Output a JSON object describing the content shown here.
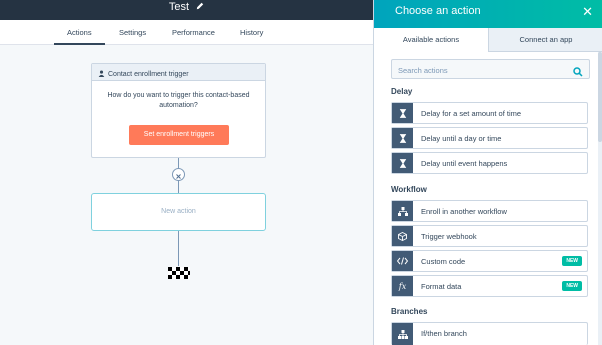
{
  "header": {
    "title": "Test"
  },
  "tabs": [
    {
      "label": "Actions",
      "active": true
    },
    {
      "label": "Settings",
      "active": false
    },
    {
      "label": "Performance",
      "active": false
    },
    {
      "label": "History",
      "active": false
    }
  ],
  "canvas": {
    "trigger_card": {
      "title": "Contact enrollment trigger",
      "question": "How do you want to trigger this contact-based automation?",
      "button": "Set enrollment triggers"
    },
    "new_action": "New action"
  },
  "panel": {
    "title": "Choose an action",
    "tabs": [
      "Available actions",
      "Connect an app"
    ],
    "search_placeholder": "Search actions",
    "sections": [
      {
        "title": "Delay",
        "items": [
          {
            "label": "Delay for a set amount of time",
            "icon": "hourglass-icon"
          },
          {
            "label": "Delay until a day or time",
            "icon": "hourglass-icon"
          },
          {
            "label": "Delay until event happens",
            "icon": "hourglass-icon"
          }
        ]
      },
      {
        "title": "Workflow",
        "items": [
          {
            "label": "Enroll in another workflow",
            "icon": "workflow-icon"
          },
          {
            "label": "Trigger webhook",
            "icon": "webhook-icon"
          },
          {
            "label": "Custom code",
            "icon": "code-icon",
            "badge": "NEW"
          },
          {
            "label": "Format data",
            "icon": "function-icon",
            "badge": "NEW"
          }
        ]
      },
      {
        "title": "Branches",
        "items": [
          {
            "label": "If/then branch",
            "icon": "branch-icon"
          }
        ]
      }
    ]
  },
  "colors": {
    "topbar": "#253342",
    "accent_gradient_start": "#00a4bd",
    "accent_gradient_end": "#00bda5",
    "primary_button": "#ff7a59",
    "icon_tile": "#425b76",
    "badge": "#00bda5"
  }
}
